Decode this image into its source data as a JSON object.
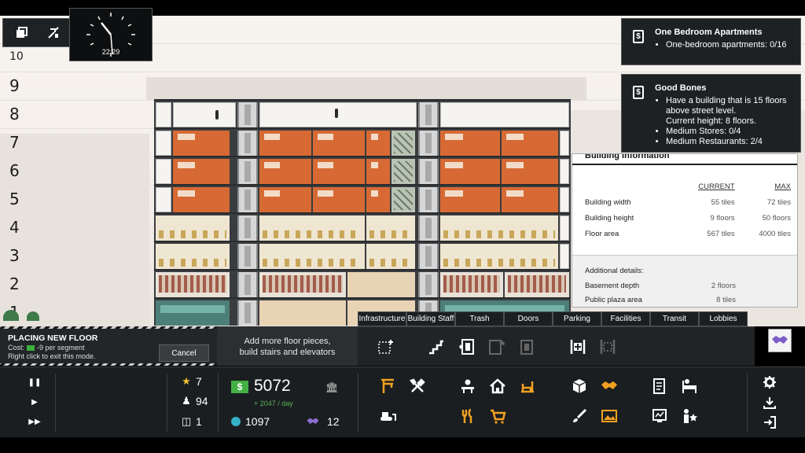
{
  "floor_numbers": [
    "10",
    "9",
    "8",
    "7",
    "6",
    "5",
    "4",
    "3",
    "2",
    "1"
  ],
  "top_tools": [
    {
      "name": "copy-floors-icon"
    },
    {
      "name": "demolish-icon"
    },
    {
      "name": "building-view-icon"
    },
    {
      "name": "chevron-down-icon"
    }
  ],
  "goals": [
    {
      "title": "One Bedroom Apartments",
      "items": [
        "One-bedroom apartments: 0/16"
      ]
    },
    {
      "title": "Good Bones",
      "items": [
        "Have a building that is 15 floors",
        "above street level.",
        "Current height: 8 floors.",
        "Medium Stores: 0/4",
        "Medium Restaurants: 2/4"
      ]
    }
  ],
  "building_info": {
    "title": "Building Information",
    "col_current": "CURRENT",
    "col_max": "MAX",
    "rows": [
      {
        "label": "Building width",
        "current": "55 tiles",
        "max": "72 tiles"
      },
      {
        "label": "Building height",
        "current": "9 floors",
        "max": "50 floors"
      },
      {
        "label": "Floor area",
        "current": "567 tiles",
        "max": "4000 tiles"
      }
    ],
    "details_label": "Additional details:",
    "details": [
      {
        "label": "Basement depth",
        "value": "2 floors"
      },
      {
        "label": "Public plaza area",
        "value": "8 tiles"
      }
    ]
  },
  "tabs": [
    "Infrastructure",
    "Building Staff",
    "Trash",
    "Doors",
    "Parking",
    "Facilities",
    "Transit",
    "Lobbies"
  ],
  "placing": {
    "title": "PLACING NEW FLOOR",
    "cost_prefix": "Cost:",
    "cost_value": "-9 per segment",
    "hint": "Right click to exit this mode.",
    "cancel": "Cancel"
  },
  "hint_panel": {
    "line1": "Add more floor pieces,",
    "line2": "build stairs and elevators"
  },
  "build_tools": [
    "add-floor-icon",
    "stairs-icon",
    "elevator-icon",
    "express-elevator-icon",
    "service-elevator-icon",
    "add-basement-icon",
    "basement-icon"
  ],
  "hud": {
    "clock_time": "22:29",
    "stars": "7",
    "population": "94",
    "elevators": "1",
    "money": "5072",
    "money_rate": "+ 2047 / day",
    "eco_points": "1097",
    "deals": "12"
  },
  "hud_tools": [
    "construction-icon",
    "repair-tools-icon",
    "office-desk-icon",
    "home-icon",
    "restaurant-icon",
    "bulldozer-icon",
    "food-icon",
    "shopping-cart-icon",
    "storage-box-icon",
    "handshake-icon",
    "document-icon",
    "hotel-bed-icon",
    "paint-brush-icon",
    "art-frame-icon",
    "stats-icon",
    "review-icon"
  ],
  "right_tools": [
    "settings-icon",
    "save-icon",
    "exit-icon"
  ],
  "colors": {
    "apartment": "#d76a34",
    "money_green": "#44b044",
    "rate_green": "#57b357",
    "star_yellow": "#f2c230",
    "accent_orange": "#f0a020",
    "deals_purple": "#8c6fd6"
  }
}
